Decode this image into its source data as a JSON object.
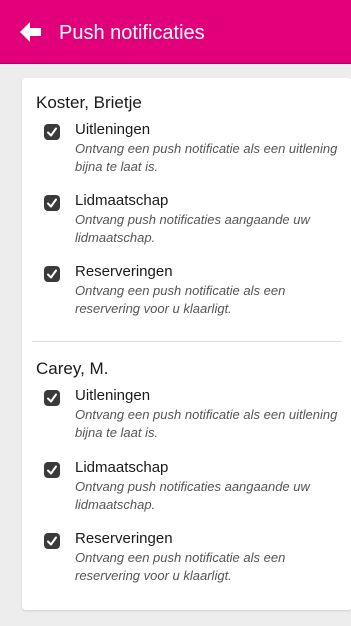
{
  "header": {
    "title": "Push notificaties",
    "icon": "back-arrow-icon",
    "color": "#e1007a"
  },
  "accounts": [
    {
      "name": "Koster, Brietje",
      "preferences": [
        {
          "label": "Uitleningen",
          "description": "Ontvang een push notificatie als een uitlening bijna te laat is.",
          "checked": true
        },
        {
          "label": "Lidmaatschap",
          "description": "Ontvang push notificaties aangaande uw lidmaatschap.",
          "checked": true
        },
        {
          "label": "Reserveringen",
          "description": "Ontvang een push notificatie als een reservering voor u klaarligt.",
          "checked": true
        }
      ]
    },
    {
      "name": "Carey, M.",
      "preferences": [
        {
          "label": "Uitleningen",
          "description": "Ontvang een push notificatie als een uitlening bijna te laat is.",
          "checked": true
        },
        {
          "label": "Lidmaatschap",
          "description": "Ontvang push notificaties aangaande uw lidmaatschap.",
          "checked": true
        },
        {
          "label": "Reserveringen",
          "description": "Ontvang een push notificatie als een reservering voor u klaarligt.",
          "checked": true
        }
      ]
    }
  ]
}
